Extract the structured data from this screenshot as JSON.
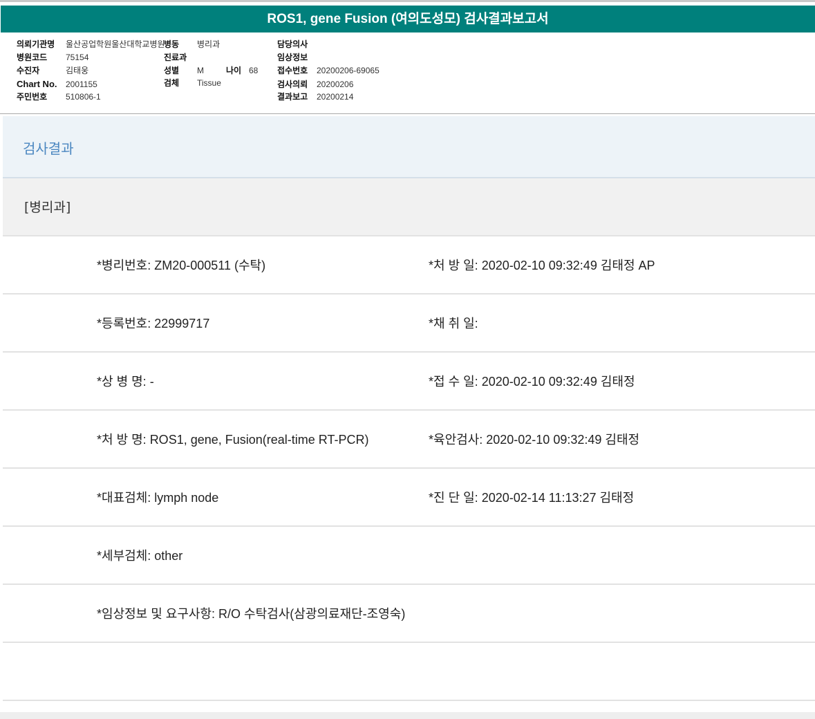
{
  "title": "ROS1, gene Fusion (여의도성모) 검사결과보고서",
  "info": {
    "institution_label": "의뢰기관명",
    "institution": "울산공업학원울산대학교병원",
    "ward_label": "병동",
    "ward": "병리과",
    "doctor_label": "담당의사",
    "hospital_code_label": "병원코드",
    "hospital_code": "75154",
    "department_label": "진료과",
    "clinical_info_label": "임상정보",
    "patient_label": "수진자",
    "patient": "김태웅",
    "sex_label": "성별",
    "sex": "M",
    "age_label": "나이",
    "age": "68",
    "receipt_no_label": "접수번호",
    "receipt_no": "20200206-69065",
    "chart_label": "Chart No.",
    "chart": "2001155",
    "specimen_label": "검체",
    "specimen": "Tissue",
    "request_date_label": "검사의뢰",
    "request_date": "20200206",
    "rrn_label": "주민번호",
    "rrn": "510806-1",
    "report_date_label": "결과보고",
    "report_date": "20200214"
  },
  "section_title": "검사결과",
  "sub_title": "[병리과]",
  "rows": [
    {
      "left": "*병리번호: ZM20-000511 (수탁)",
      "right": "*처 방 일: 2020-02-10 09:32:49  김태정 AP"
    },
    {
      "left": "*등록번호: 22999717",
      "right": "*채 취 일:"
    },
    {
      "left": "*상 병 명: -",
      "right": "*접 수 일: 2020-02-10 09:32:49  김태정"
    },
    {
      "left": "*처 방 명: ROS1, gene, Fusion(real-time RT-PCR)",
      "right": "*육안검사: 2020-02-10 09:32:49  김태정"
    },
    {
      "left": "*대표검체: lymph node",
      "right": "*진 단 일: 2020-02-14 11:13:27  김태정"
    },
    {
      "left": "*세부검체: other",
      "right": ""
    },
    {
      "left": "*임상정보 및 요구사항: R/O 수탁검사(삼광의료재단-조영숙)",
      "right": ""
    },
    {
      "left": "",
      "right": ""
    }
  ]
}
